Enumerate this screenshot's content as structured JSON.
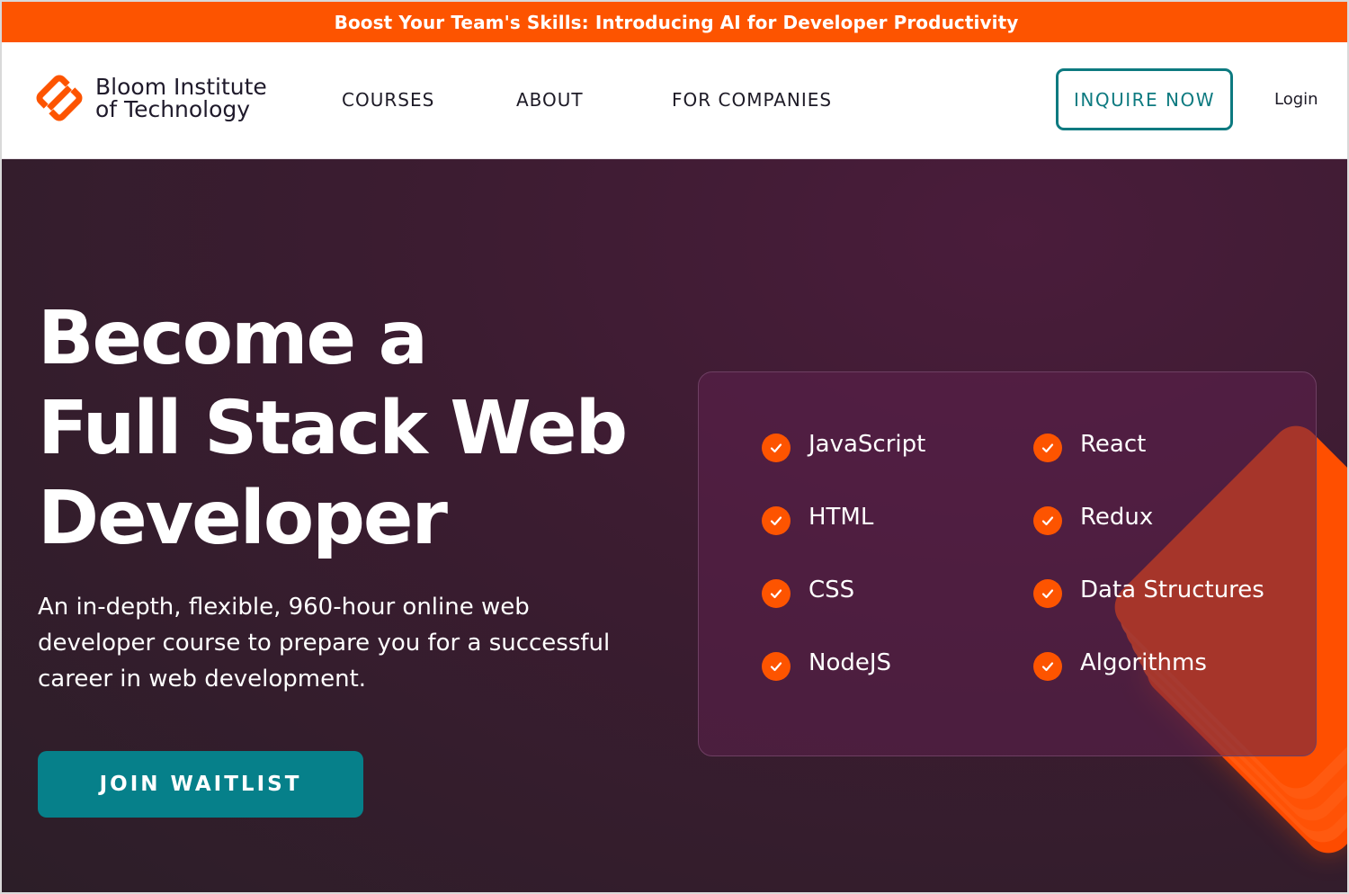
{
  "announcement": {
    "text": "Boost Your Team's Skills: Introducing AI for Developer Productivity"
  },
  "header": {
    "logo_line1": "Bloom Institute",
    "logo_line2": "of Technology",
    "nav": {
      "courses": "COURSES",
      "about": "ABOUT",
      "companies": "FOR COMPANIES"
    },
    "inquire_label": "INQUIRE NOW",
    "login_label": "Login"
  },
  "hero": {
    "title_line1": "Become a",
    "title_line2": "Full Stack Web",
    "title_line3": "Developer",
    "description": "An in-depth, flexible, 960-hour online web developer course to prepare you for a successful career in web development.",
    "cta_label": "JOIN WAITLIST"
  },
  "skills": {
    "left": [
      "JavaScript",
      "HTML",
      "CSS",
      "NodeJS"
    ],
    "right": [
      "React",
      "Redux",
      "Data Structures",
      "Algorithms"
    ]
  },
  "colors": {
    "accent_orange": "#fd5400",
    "teal": "#0d7a80",
    "hero_bg": "#3c1c31"
  },
  "icons": {
    "logo": "bloom-logo-icon",
    "check": "check-icon"
  }
}
